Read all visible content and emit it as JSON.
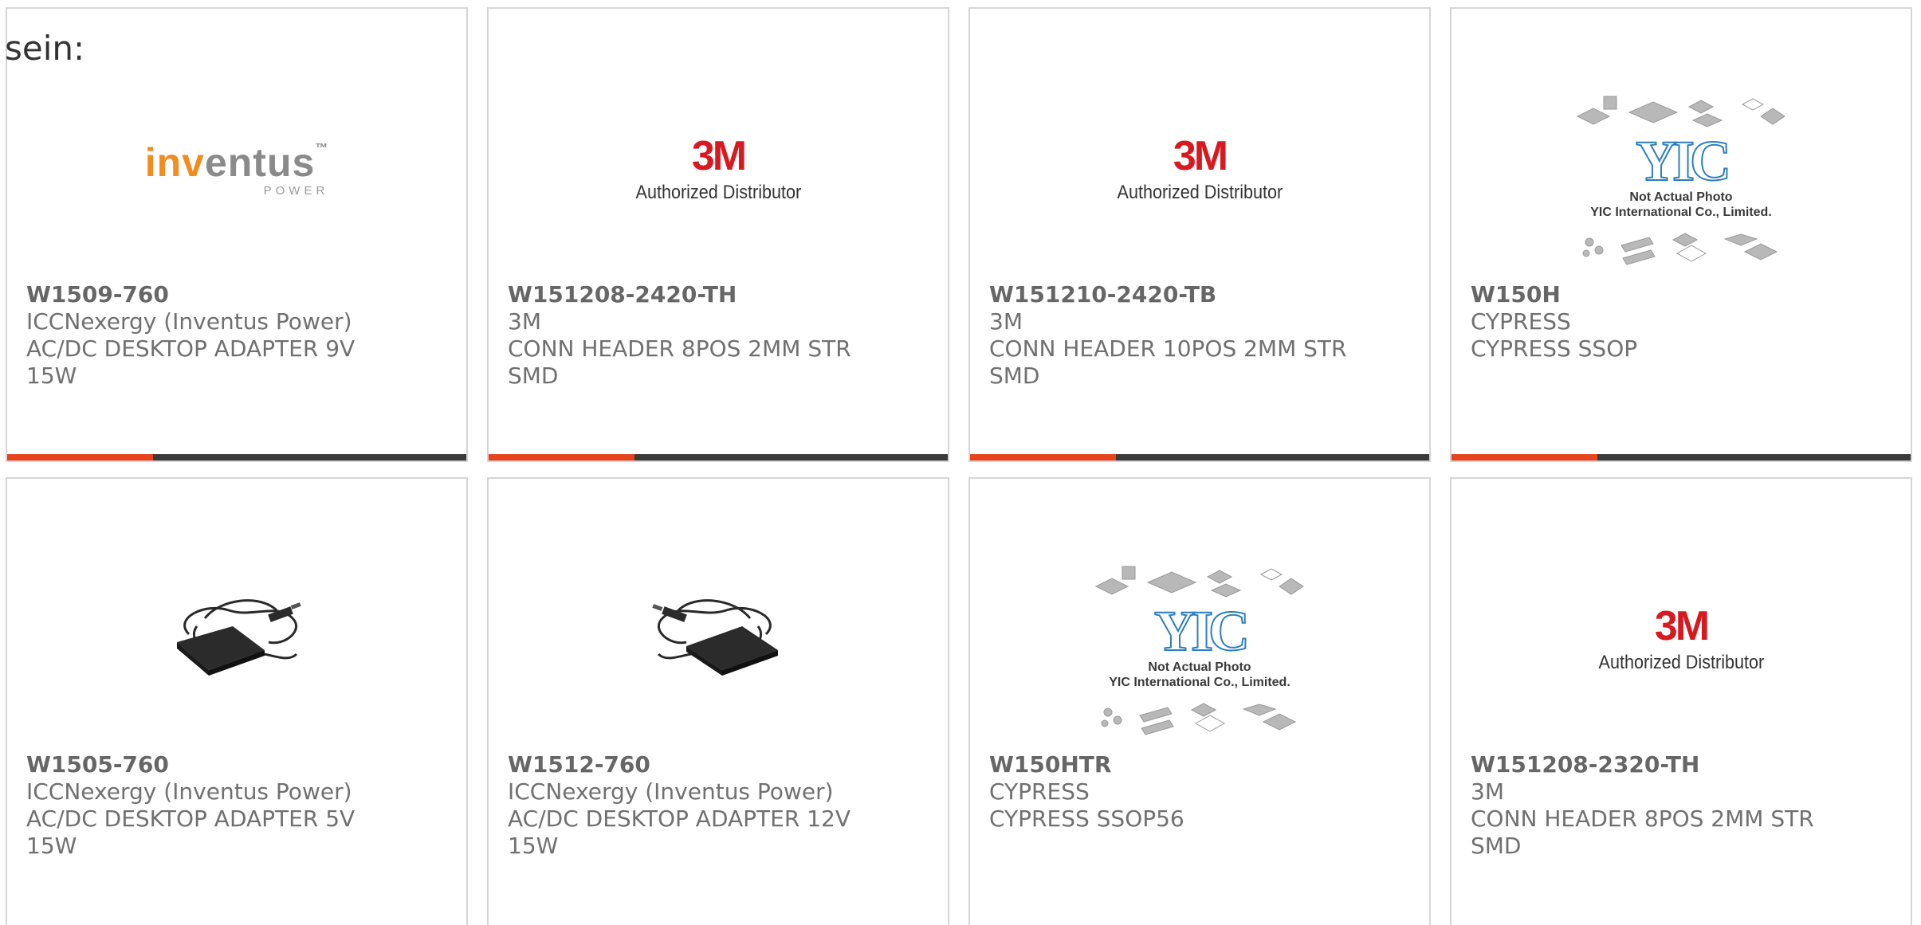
{
  "intro_text": "sein:",
  "colors": {
    "accent": "#e7431f",
    "bar": "#3b3b3b",
    "border": "#d6d6d6",
    "text": "#707070",
    "brand_3m": "#d71920",
    "brand_yic": "#2b7ec0"
  },
  "logos": {
    "m3": {
      "mark": "3M",
      "tagline": "Authorized Distributor"
    },
    "inventus": {
      "name_part1": "in",
      "name_part2": "v",
      "name_part3": "entus",
      "tm": "™",
      "sub": "POWER"
    },
    "yic": {
      "mark": "YIC",
      "note1": "Not Actual Photo",
      "note2": "YIC International Co., Limited."
    }
  },
  "products": [
    {
      "part_number": "W1509-760",
      "manufacturer": "ICCNexergy (Inventus Power)",
      "description_line1": "AC/DC DESKTOP ADAPTER 9V",
      "description_line2": "15W",
      "image_icon": "inventus-logo"
    },
    {
      "part_number": "W151208-2420-TH",
      "manufacturer": "3M",
      "description_line1": "CONN HEADER 8POS 2MM STR",
      "description_line2": "SMD",
      "image_icon": "3m-logo"
    },
    {
      "part_number": "W151210-2420-TB",
      "manufacturer": "3M",
      "description_line1": "CONN HEADER 10POS 2MM STR",
      "description_line2": "SMD",
      "image_icon": "3m-logo"
    },
    {
      "part_number": "W150H",
      "manufacturer": "CYPRESS",
      "description_line1": "CYPRESS SSOP",
      "description_line2": "",
      "image_icon": "yic-placeholder"
    },
    {
      "part_number": "W1505-760",
      "manufacturer": "ICCNexergy (Inventus Power)",
      "description_line1": "AC/DC DESKTOP ADAPTER 5V",
      "description_line2": "15W",
      "image_icon": "power-adapter-photo"
    },
    {
      "part_number": "W1512-760",
      "manufacturer": "ICCNexergy (Inventus Power)",
      "description_line1": "AC/DC DESKTOP ADAPTER 12V",
      "description_line2": "15W",
      "image_icon": "power-adapter-photo"
    },
    {
      "part_number": "W150HTR",
      "manufacturer": "CYPRESS",
      "description_line1": "CYPRESS SSOP56",
      "description_line2": "",
      "image_icon": "yic-placeholder"
    },
    {
      "part_number": "W151208-2320-TH",
      "manufacturer": "3M",
      "description_line1": "CONN HEADER 8POS 2MM STR",
      "description_line2": "SMD",
      "image_icon": "3m-logo"
    }
  ]
}
